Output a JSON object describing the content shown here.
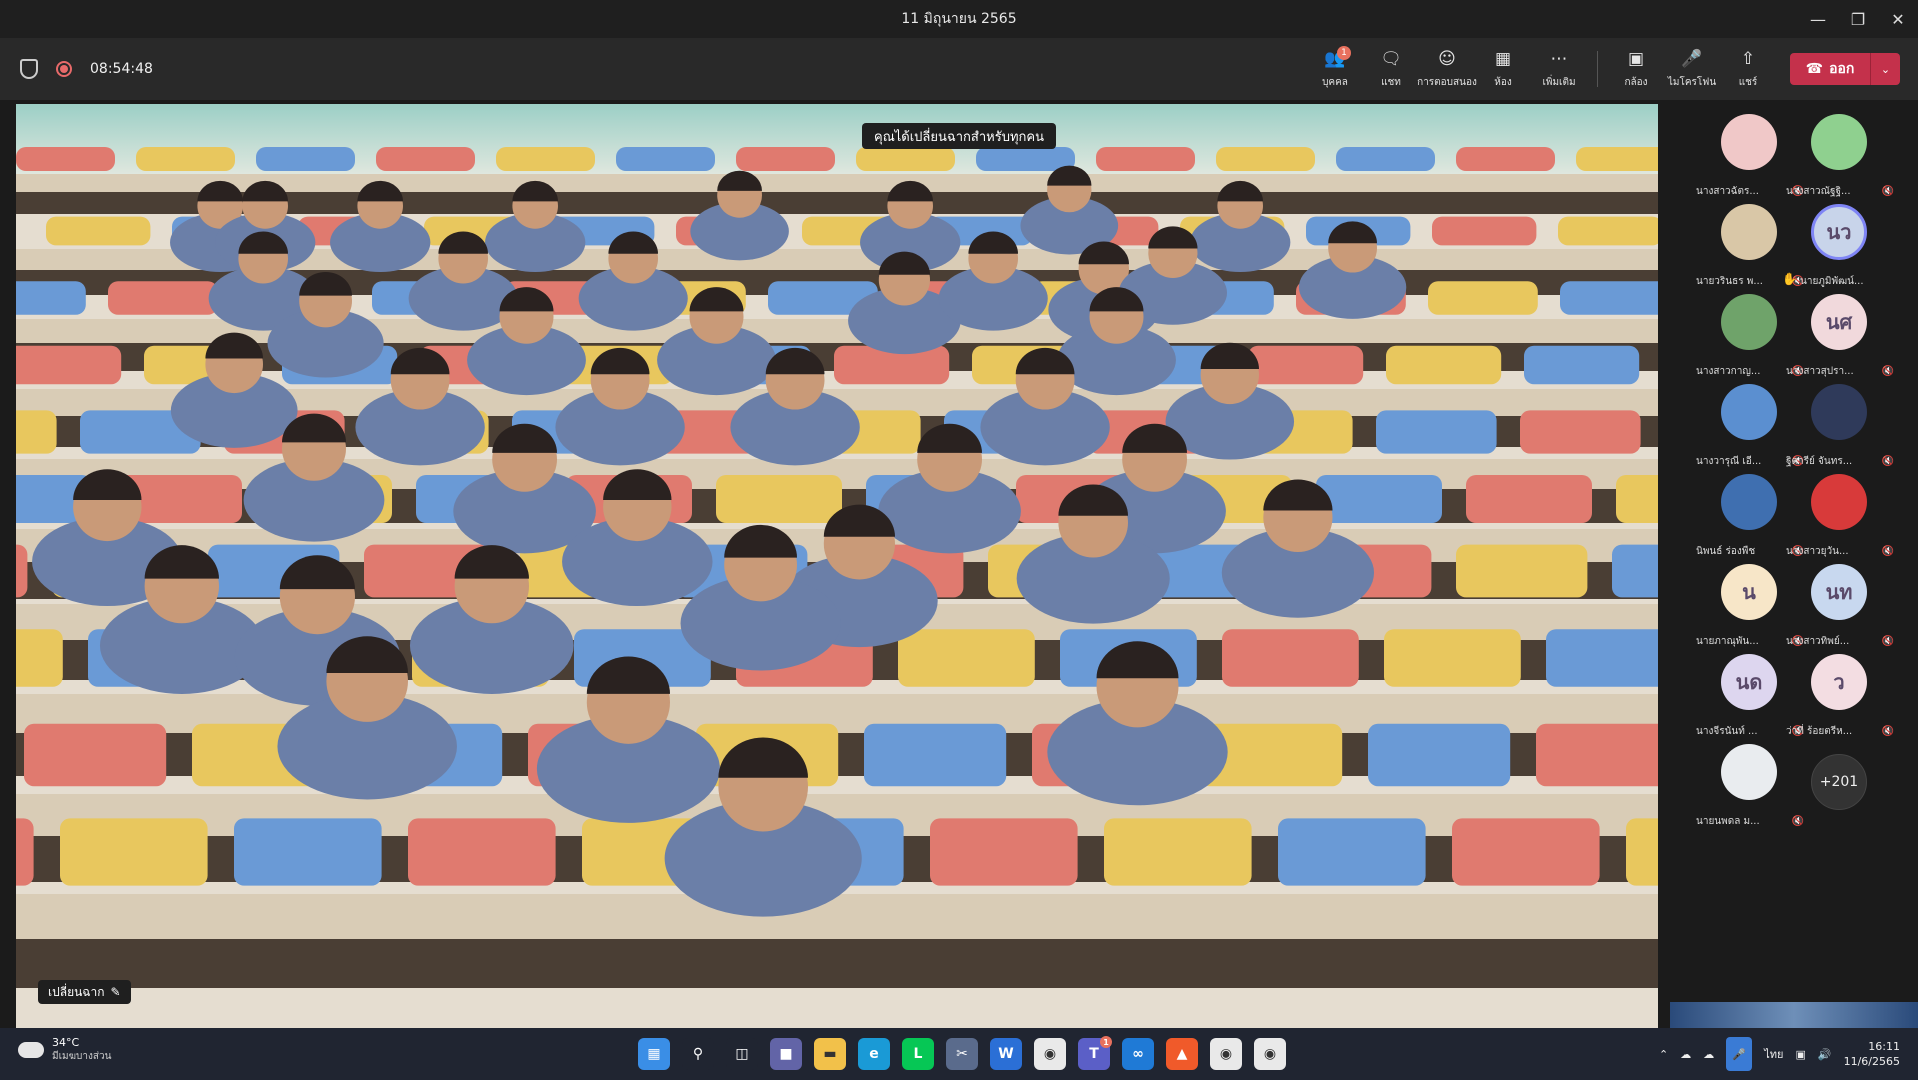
{
  "window": {
    "title": "11 มิถุนายน 2565",
    "controls": [
      "minimize",
      "restore",
      "close"
    ]
  },
  "toolbar": {
    "timer": "08:54:48",
    "buttons": [
      {
        "name": "people",
        "label": "บุคคล",
        "icon": "people-icon",
        "badge": "1"
      },
      {
        "name": "chat",
        "label": "แชท",
        "icon": "chat-icon",
        "badge": ""
      },
      {
        "name": "reactions",
        "label": "การตอบสนอง",
        "icon": "reaction-icon",
        "badge": ""
      },
      {
        "name": "rooms",
        "label": "ห้อง",
        "icon": "rooms-icon",
        "badge": ""
      },
      {
        "name": "more",
        "label": "เพิ่มเติม",
        "icon": "more-icon",
        "badge": ""
      },
      {
        "name": "camera",
        "label": "กล้อง",
        "icon": "camera-icon",
        "badge": ""
      },
      {
        "name": "mic",
        "label": "ไมโครโฟน",
        "icon": "mic-icon",
        "badge": ""
      },
      {
        "name": "share",
        "label": "แชร์",
        "icon": "share-icon",
        "badge": ""
      }
    ],
    "leave_label": "ออก",
    "leave_color": "#c4314b"
  },
  "stage": {
    "notice": "คุณได้เปลี่ยนฉากสำหรับทุกคน",
    "change_bg_label": "เปลี่ยนฉาก"
  },
  "participants": [
    {
      "name": "นางสาวฉัตร...",
      "initials": "",
      "color": "#f0c8c8",
      "muted": true,
      "hand": false
    },
    {
      "name": "นางสาวณัฐฐิ...",
      "initials": "",
      "color": "#8fd08f",
      "muted": true,
      "hand": false
    },
    {
      "name": "นายวรินธร พ...",
      "initials": "",
      "color": "#d9c7a7",
      "muted": true,
      "hand": false
    },
    {
      "name": "นายภูมิพัฒน์...",
      "initials": "นว",
      "color": "#c8d4ea",
      "muted": false,
      "hand": true
    },
    {
      "name": "นางสาวกาญ...",
      "initials": "",
      "color": "#6fa36a",
      "muted": true,
      "hand": false
    },
    {
      "name": "นางสาวสุปรา...",
      "initials": "นศ",
      "color": "#f1d9dc",
      "muted": true,
      "hand": false
    },
    {
      "name": "นางวารุณี เอี...",
      "initials": "",
      "color": "#5b8fd0",
      "muted": true,
      "hand": false
    },
    {
      "name": "ฐิตารีย์ จันทร...",
      "initials": "",
      "color": "#2f3a5a",
      "muted": true,
      "hand": false
    },
    {
      "name": "นิพนธ์ ร่องพืช",
      "initials": "",
      "color": "#3f6fb0",
      "muted": true,
      "hand": false
    },
    {
      "name": "นางสาวยุวัน...",
      "initials": "",
      "color": "#d83a3a",
      "muted": true,
      "hand": false
    },
    {
      "name": "นายภาณุพัน...",
      "initials": "น",
      "color": "#f7e6c8",
      "muted": true,
      "hand": false
    },
    {
      "name": "นางสาวทิพย์...",
      "initials": "นท",
      "color": "#c8d8ef",
      "muted": true,
      "hand": false
    },
    {
      "name": "นางจีรนันท์ ...",
      "initials": "นด",
      "color": "#ddd6ef",
      "muted": true,
      "hand": false
    },
    {
      "name": "ว่าที่ ร้อยตรีห...",
      "initials": "ว",
      "color": "#f3dde2",
      "muted": true,
      "hand": false
    },
    {
      "name": "นายนพดล ม...",
      "initials": "",
      "color": "#e9ecef",
      "muted": true,
      "hand": false
    }
  ],
  "overflow_count": "+201",
  "taskbar": {
    "weather_temp": "34°C",
    "weather_desc": "มีเมฆบางส่วน",
    "apps": [
      {
        "name": "start",
        "icon": "windows-icon",
        "color": "#3a8ee6",
        "badge": ""
      },
      {
        "name": "search",
        "icon": "search-icon",
        "color": "#202531",
        "badge": ""
      },
      {
        "name": "task-view",
        "icon": "taskview-icon",
        "color": "#202531",
        "badge": ""
      },
      {
        "name": "teams-chat",
        "icon": "teams-chat-icon",
        "color": "#6264a7",
        "badge": ""
      },
      {
        "name": "file-explorer",
        "icon": "folder-icon",
        "color": "#f2c14a",
        "badge": ""
      },
      {
        "name": "edge",
        "icon": "edge-icon",
        "color": "#1a9ad6",
        "badge": ""
      },
      {
        "name": "line",
        "icon": "line-icon",
        "color": "#06c755",
        "badge": ""
      },
      {
        "name": "snipping",
        "icon": "snip-icon",
        "color": "#5a6b8c",
        "badge": ""
      },
      {
        "name": "word",
        "icon": "word-icon",
        "color": "#2b6fd6",
        "badge": ""
      },
      {
        "name": "chrome",
        "icon": "chrome-icon",
        "color": "#e9e9e9",
        "badge": ""
      },
      {
        "name": "teams",
        "icon": "teams-icon",
        "color": "#5b5fc7",
        "badge": "1"
      },
      {
        "name": "webex",
        "icon": "webex-icon",
        "color": "#1f7ad6",
        "badge": ""
      },
      {
        "name": "brave",
        "icon": "brave-icon",
        "color": "#f05a2a",
        "badge": ""
      },
      {
        "name": "chrome-2",
        "icon": "chrome-icon",
        "color": "#e9e9e9",
        "badge": ""
      },
      {
        "name": "chrome-3",
        "icon": "chrome-icon",
        "color": "#e9e9e9",
        "badge": ""
      }
    ],
    "lang": "ไทย",
    "time": "16:11",
    "date": "11/6/2565"
  }
}
